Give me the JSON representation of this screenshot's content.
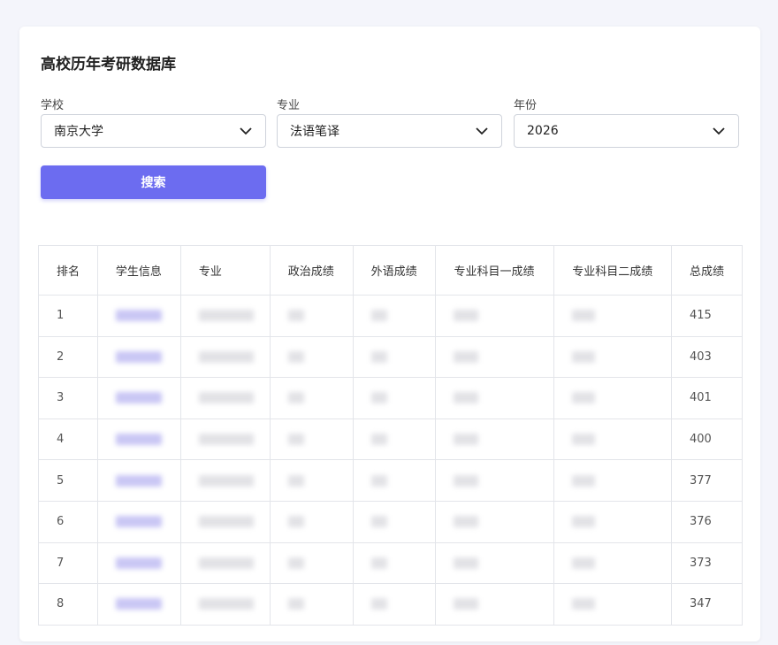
{
  "page_title": "高校历年考研数据库",
  "filters": {
    "school": {
      "label": "学校",
      "value": "南京大学"
    },
    "major": {
      "label": "专业",
      "value": "法语笔译"
    },
    "year": {
      "label": "年份",
      "value": "2026"
    }
  },
  "search_button": "搜索",
  "table": {
    "headers": [
      "排名",
      "学生信息",
      "专业",
      "政治成绩",
      "外语成绩",
      "专业科目一成绩",
      "专业科目二成绩",
      "总成绩"
    ],
    "rows": [
      {
        "rank": "1",
        "total": "415"
      },
      {
        "rank": "2",
        "total": "403"
      },
      {
        "rank": "3",
        "total": "401"
      },
      {
        "rank": "4",
        "total": "400"
      },
      {
        "rank": "5",
        "total": "377"
      },
      {
        "rank": "6",
        "total": "376"
      },
      {
        "rank": "7",
        "total": "373"
      },
      {
        "rank": "8",
        "total": "347"
      }
    ]
  },
  "colors": {
    "primary": "#6c6cf0",
    "background": "#f4f5fb",
    "border": "#e3e5ea"
  }
}
